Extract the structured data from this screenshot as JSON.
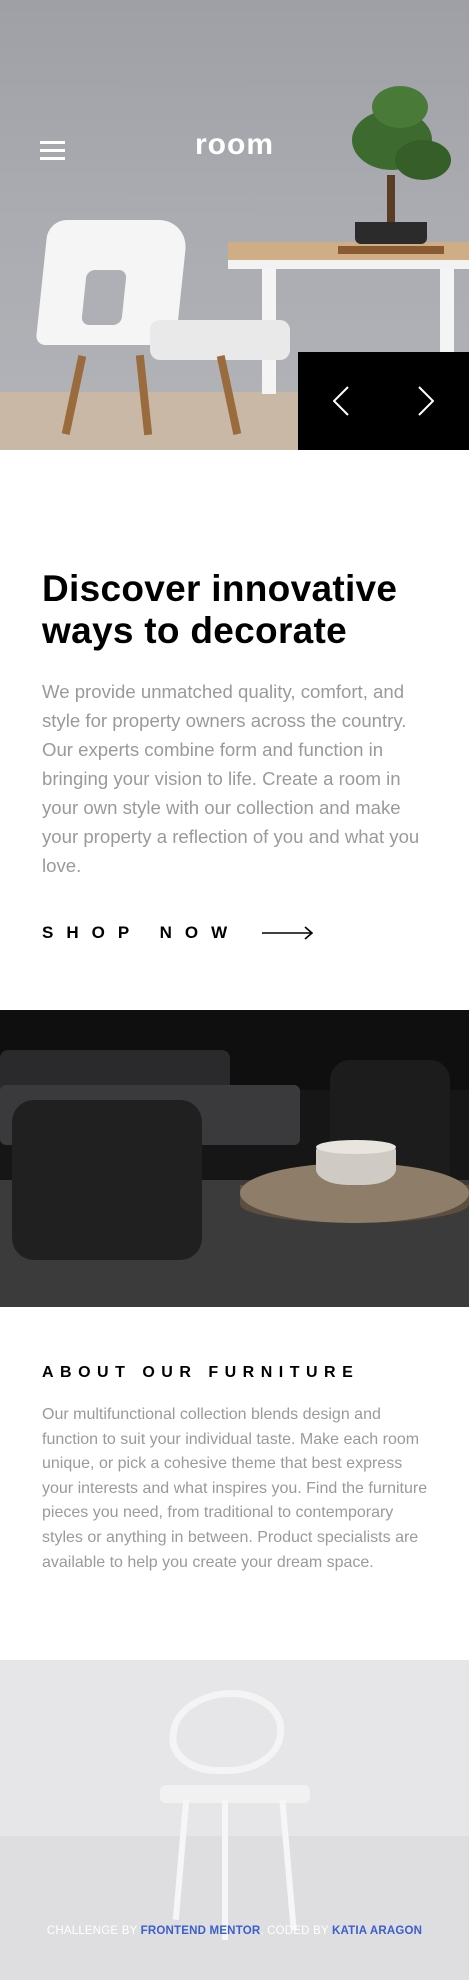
{
  "header": {
    "logo": "room",
    "menu_icon": "hamburger-menu-icon",
    "prev_icon": "chevron-left-icon",
    "next_icon": "chevron-right-icon"
  },
  "discover": {
    "title": "Discover innovative ways to decorate",
    "body": "We provide unmatched quality, comfort, and style for property owners across the country. Our experts combine form and function in bringing your vision to life. Create a room in your own style with our collection and make your property a reflection of you and what you love.",
    "cta_label": "SHOP NOW",
    "cta_icon": "arrow-right-icon"
  },
  "about": {
    "title": "ABOUT OUR FURNITURE",
    "body": "Our multifunctional collection blends design and function to suit your individual taste. Make each room unique, or pick a cohesive theme that best express your interests and what inspires you. Find the furniture pieces you need, from traditional to contemporary styles or anything in between. Product specialists are available to help you create your dream space."
  },
  "attribution": {
    "prefix": "CHALLENGE BY",
    "link1": "FRONTEND MENTOR",
    "middle": ". CODED BY",
    "link2": "KATIA ARAGON"
  },
  "colors": {
    "text_primary": "#000000",
    "text_secondary": "#9a9a9a",
    "controls_bg": "#000000",
    "link": "#3a5fcd"
  }
}
